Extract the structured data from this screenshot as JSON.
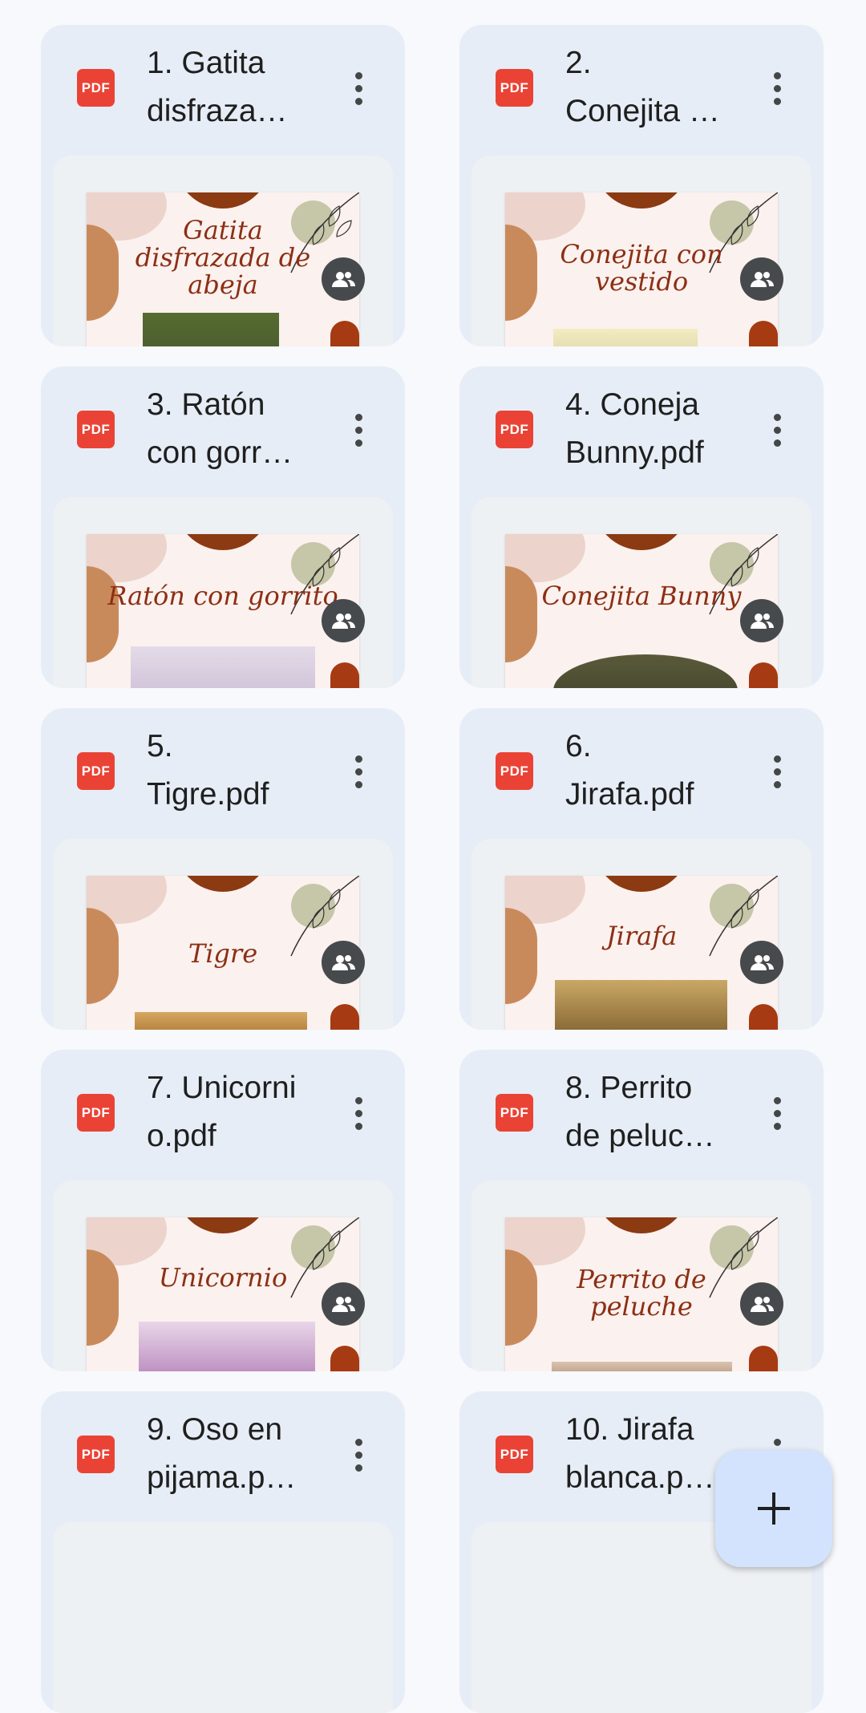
{
  "files": [
    {
      "name": "1. Gatita\ndisfraza…",
      "thumb_title": "Gatita disfrazada de abeja",
      "type_icon": "pdf-icon",
      "badge_text": "PDF",
      "shared": true
    },
    {
      "name": "2.\nConejita …",
      "thumb_title": "Conejita con vestido",
      "type_icon": "pdf-icon",
      "badge_text": "PDF",
      "shared": true
    },
    {
      "name": "3. Ratón\ncon gorr…",
      "thumb_title": "Ratón con gorrito",
      "type_icon": "pdf-icon",
      "badge_text": "PDF",
      "shared": true
    },
    {
      "name": "4. Coneja\nBunny.pdf",
      "thumb_title": "Conejita Bunny",
      "type_icon": "pdf-icon",
      "badge_text": "PDF",
      "shared": true
    },
    {
      "name": "5.\nTigre.pdf",
      "thumb_title": "Tigre",
      "type_icon": "pdf-icon",
      "badge_text": "PDF",
      "shared": true
    },
    {
      "name": "6.\nJirafa.pdf",
      "thumb_title": "Jirafa",
      "type_icon": "pdf-icon",
      "badge_text": "PDF",
      "shared": true
    },
    {
      "name": "7. Unicorni\no.pdf",
      "thumb_title": "Unicornio",
      "type_icon": "pdf-icon",
      "badge_text": "PDF",
      "shared": true
    },
    {
      "name": "8. Perrito\nde peluc…",
      "thumb_title": "Perrito de peluche",
      "type_icon": "pdf-icon",
      "badge_text": "PDF",
      "shared": true
    },
    {
      "name": "9. Oso en\npijama.p…",
      "thumb_title": "",
      "type_icon": "pdf-icon",
      "badge_text": "PDF",
      "shared": false
    },
    {
      "name": "10. Jirafa\nblanca.p…",
      "thumb_title": "",
      "type_icon": "pdf-icon",
      "badge_text": "PDF",
      "shared": false
    }
  ],
  "fab": {
    "icon": "plus-icon",
    "label": "+"
  },
  "colors": {
    "card_bg": "#e6edf6",
    "pdf_red": "#ea4335",
    "fab_bg": "#d3e3fd",
    "thumb_title": "#8c2f14"
  }
}
